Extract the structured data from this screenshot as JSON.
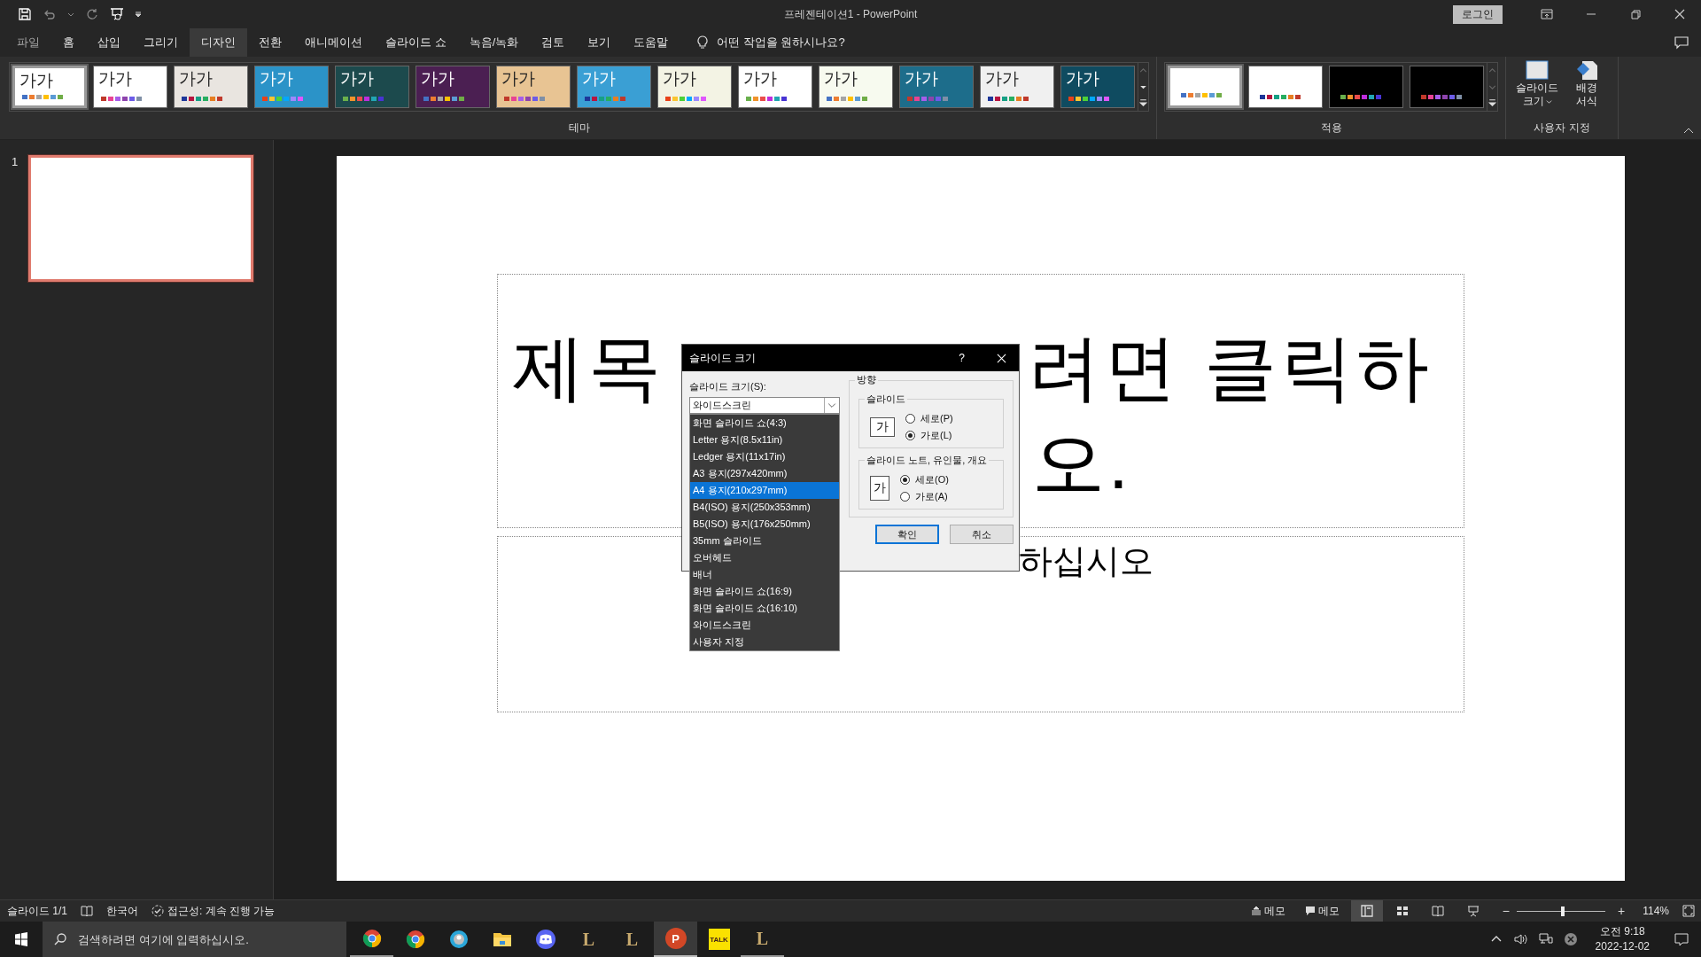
{
  "window": {
    "title": "프레젠테이션1  -  PowerPoint",
    "login": "로그인"
  },
  "tabs": [
    {
      "label": "파일",
      "selected": false
    },
    {
      "label": "홈",
      "selected": false
    },
    {
      "label": "삽입",
      "selected": false
    },
    {
      "label": "그리기",
      "selected": false
    },
    {
      "label": "디자인",
      "selected": true
    },
    {
      "label": "전환",
      "selected": false
    },
    {
      "label": "애니메이션",
      "selected": false
    },
    {
      "label": "슬라이드 쇼",
      "selected": false
    },
    {
      "label": "녹음/녹화",
      "selected": false
    },
    {
      "label": "검토",
      "selected": false
    },
    {
      "label": "보기",
      "selected": false
    },
    {
      "label": "도움말",
      "selected": false
    }
  ],
  "tell_me": "어떤 작업을 원하시나요?",
  "ribbon": {
    "themes": {
      "label": "테마",
      "items": [
        {
          "label": "가가",
          "color": "#ffffff",
          "selected": true
        },
        {
          "label": "가가",
          "color": "#ffffff",
          "selected": false
        },
        {
          "label": "가가",
          "color": "#e9e5e0",
          "selected": false
        },
        {
          "label": "가가",
          "color": "#2b93c8",
          "selected": false
        },
        {
          "label": "가가",
          "color": "#1c4a4d",
          "selected": false
        },
        {
          "label": "가가",
          "color": "#4b1f52",
          "selected": false
        },
        {
          "label": "가가",
          "color": "#e8c493",
          "selected": false
        },
        {
          "label": "가가",
          "color": "#3a9fd4",
          "selected": false
        },
        {
          "label": "가가",
          "color": "#f3f3e4",
          "selected": false
        },
        {
          "label": "가가",
          "color": "#ffffff",
          "selected": false
        },
        {
          "label": "가가",
          "color": "#f7faef",
          "selected": false
        },
        {
          "label": "가가",
          "color": "#1d6d8b",
          "selected": false
        },
        {
          "label": "가가",
          "color": "#f0f0f0",
          "selected": false
        },
        {
          "label": "가가",
          "color": "#0f4b60",
          "selected": false
        }
      ]
    },
    "variants": {
      "label": "적용",
      "items": [
        {
          "color": "#ffffff",
          "selected": true
        },
        {
          "color": "#ffffff",
          "selected": false
        },
        {
          "color": "#000000",
          "selected": false
        },
        {
          "color": "#000000",
          "selected": false
        }
      ]
    },
    "customize": {
      "label": "사용자 지정",
      "buttons": [
        {
          "label": "슬라이드 크기",
          "kind": "size",
          "dropdown": true
        },
        {
          "label": "배경 서식",
          "kind": "background",
          "dropdown": false
        }
      ]
    }
  },
  "slides_pane": [
    {
      "number": "1",
      "selected": true
    }
  ],
  "slide": {
    "title_parts": [
      "제목",
      "려면 클릭하",
      "오."
    ],
    "subtitle_parts": [
      "하십시오"
    ]
  },
  "dialog": {
    "title": "슬라이드 크기",
    "help": "?",
    "size_label": "슬라이드 크기(S):",
    "size_value": "와이드스크린",
    "options": [
      {
        "label": "화면 슬라이드 쇼(4:3)",
        "selected": false
      },
      {
        "label": "Letter 용지(8.5x11in)",
        "selected": false
      },
      {
        "label": "Ledger 용지(11x17in)",
        "selected": false
      },
      {
        "label": "A3 용지(297x420mm)",
        "selected": false
      },
      {
        "label": "A4 용지(210x297mm)",
        "selected": true
      },
      {
        "label": "B4(ISO) 용지(250x353mm)",
        "selected": false
      },
      {
        "label": "B5(ISO) 용지(176x250mm)",
        "selected": false
      },
      {
        "label": "35mm 슬라이드",
        "selected": false
      },
      {
        "label": "오버헤드",
        "selected": false
      },
      {
        "label": "배너",
        "selected": false
      },
      {
        "label": "화면 슬라이드 쇼(16:9)",
        "selected": false
      },
      {
        "label": "화면 슬라이드 쇼(16:10)",
        "selected": false
      },
      {
        "label": "와이드스크린",
        "selected": false
      },
      {
        "label": "사용자 지정",
        "selected": false
      }
    ],
    "orientation_label": "방향",
    "groups": [
      {
        "label": "슬라이드",
        "icon_text": "가",
        "kind": "landscape",
        "radios": [
          {
            "label": "세로(P)",
            "checked": false
          },
          {
            "label": "가로(L)",
            "checked": true
          }
        ]
      },
      {
        "label": "슬라이드 노트, 유인물, 개요",
        "icon_text": "가",
        "kind": "portrait",
        "radios": [
          {
            "label": "세로(O)",
            "checked": true
          },
          {
            "label": "가로(A)",
            "checked": false
          }
        ]
      }
    ],
    "ok": "확인",
    "cancel": "취소"
  },
  "status_bar": {
    "slide": "슬라이드 1/1",
    "language": "한국어",
    "accessibility": "접근성: 계속 진행 가능",
    "notes": "메모",
    "comments": "메모",
    "views": [
      {
        "kind": "normal",
        "selected": true
      },
      {
        "kind": "sorter",
        "selected": false
      },
      {
        "kind": "reading",
        "selected": false
      },
      {
        "kind": "show",
        "selected": false
      }
    ],
    "zoom_minus": "−",
    "zoom_plus": "+",
    "zoom": {
      "level": 0.52
    },
    "zoom_text": "114%"
  },
  "taskbar": {
    "search": {
      "placeholder": "검색하려면 여기에 입력하십시오."
    },
    "apps": [
      {
        "kind": "chrome",
        "running": true,
        "selected": false
      },
      {
        "kind": "chrome",
        "running": false,
        "selected": false
      },
      {
        "kind": "edge",
        "running": false,
        "selected": false
      },
      {
        "kind": "folder",
        "running": false,
        "selected": false
      },
      {
        "kind": "discord",
        "running": false,
        "selected": false
      },
      {
        "kind": "league",
        "glyph": "L",
        "running": false,
        "selected": false
      },
      {
        "kind": "league",
        "glyph": "L",
        "running": false,
        "selected": false
      },
      {
        "kind": "powerpoint",
        "glyph": "P",
        "running": true,
        "selected": true
      },
      {
        "kind": "kakao",
        "glyph": "TALK",
        "running": false,
        "selected": false
      },
      {
        "kind": "league",
        "glyph": "L",
        "running": true,
        "selected": false
      }
    ],
    "time": "오전 9:18",
    "date": "2022-12-02"
  }
}
